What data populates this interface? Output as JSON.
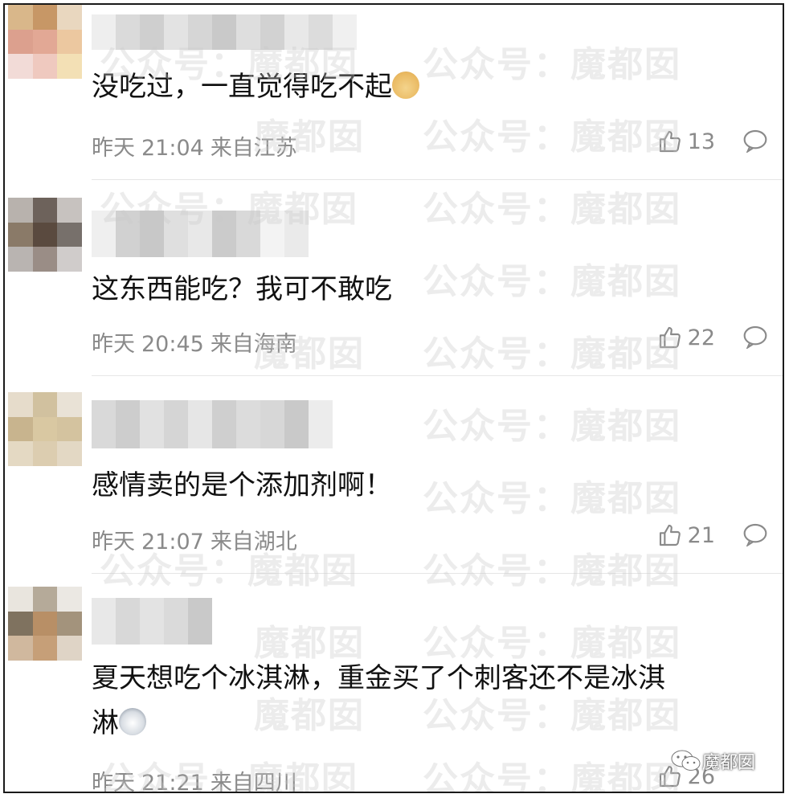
{
  "watermark": {
    "text_short": "魔都囡",
    "text_long": "公众号：魔都囡"
  },
  "comments": [
    {
      "text": "没吃过，一直觉得吃不起",
      "emoji": "doge-emoji",
      "date": "昨天",
      "time": "21:04",
      "location": "来自江苏",
      "likes": "13"
    },
    {
      "text": "这东西能吃？我可不敢吃",
      "date": "昨天",
      "time": "20:45",
      "location": "来自海南",
      "likes": "22"
    },
    {
      "text": "感情卖的是个添加剂啊！",
      "date": "昨天",
      "time": "21:07",
      "location": "来自湖北",
      "likes": "21"
    },
    {
      "text_line1": "夏天想吃个冰淇淋，重金买了个刺客还不是冰淇",
      "text_line2": "淋",
      "emoji": "husky-emoji",
      "date": "昨天",
      "time": "21:21",
      "location": "来自四川",
      "likes": "26"
    }
  ],
  "badge": {
    "label": "魔都囡",
    "icon": "wechat-icon"
  },
  "colors": {
    "meta_text": "#8a8a8a",
    "body_text": "#111111",
    "divider": "#e6e6e6"
  }
}
